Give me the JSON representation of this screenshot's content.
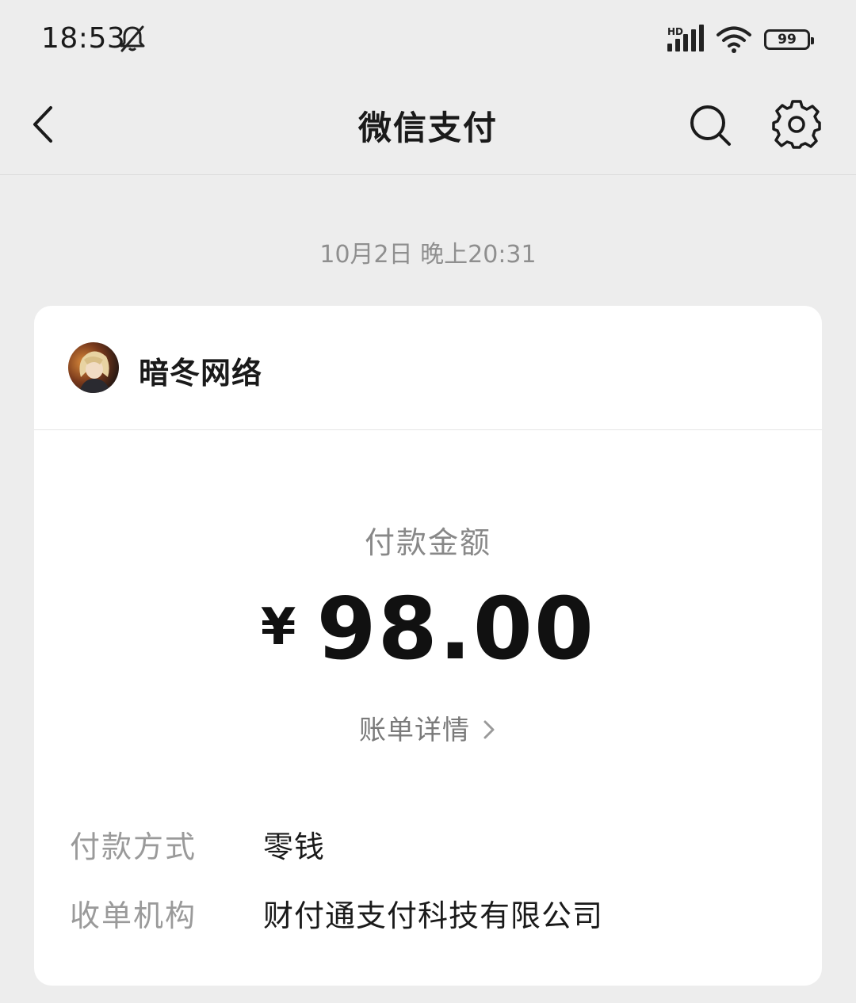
{
  "status_bar": {
    "time": "18:53",
    "signal_label": "HD",
    "battery": "99"
  },
  "nav": {
    "title": "微信支付"
  },
  "timestamp": "10月2日 晚上20:31",
  "merchant": {
    "name": "暗冬网络"
  },
  "payment": {
    "amount_label": "付款金额",
    "currency": "¥",
    "amount": "98.00",
    "bill_details_label": "账单详情"
  },
  "details": [
    {
      "label": "付款方式",
      "value": "零钱"
    },
    {
      "label": "收单机构",
      "value": "财付通支付科技有限公司"
    }
  ],
  "icons": {
    "status": [
      "bell-off-icon",
      "signal-icon",
      "wifi-icon",
      "battery-icon"
    ],
    "nav": [
      "back-arrow-icon",
      "search-icon",
      "gear-icon"
    ],
    "link": "chevron-right-icon"
  }
}
